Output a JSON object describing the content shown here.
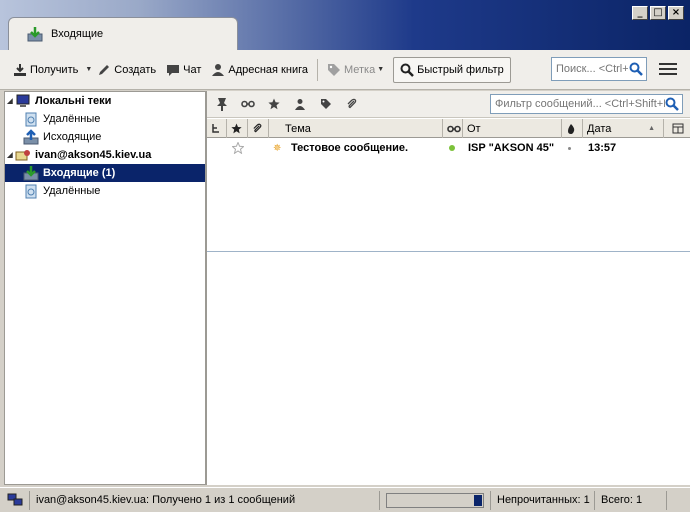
{
  "window": {
    "tab_title": "Входящие",
    "controls": {
      "minimize": "_",
      "maximize": "□",
      "close": "×"
    }
  },
  "toolbar": {
    "get_label": "Получить",
    "write_label": "Создать",
    "chat_label": "Чат",
    "addressbook_label": "Адресная книга",
    "tag_label": "Метка",
    "quickfilter_label": "Быстрый фильтр",
    "search_placeholder": "Поиск... <Ctrl+K>"
  },
  "folders": [
    {
      "label": "Локальні теки",
      "icon": "computer-icon",
      "bold": true,
      "level": 0
    },
    {
      "label": "Удалённые",
      "icon": "trash-icon",
      "level": 1
    },
    {
      "label": "Исходящие",
      "icon": "outbox-icon",
      "level": 1
    },
    {
      "label": "ivan@akson45.kiev.ua",
      "icon": "account-icon",
      "bold": true,
      "level": 0
    },
    {
      "label": "Входящие (1)",
      "icon": "inbox-icon",
      "bold": true,
      "selected": true,
      "level": 1
    },
    {
      "label": "Удалённые",
      "icon": "trash-icon",
      "level": 1
    }
  ],
  "quickfilter": {
    "placeholder": "Фильтр сообщений... <Ctrl+Shift+K>"
  },
  "columns": {
    "subject": "Тема",
    "from": "От",
    "date": "Дата"
  },
  "messages": [
    {
      "subject": "Тестовое сообщение.",
      "from": "ISP \"AKSON 45\"",
      "date": "13:57",
      "unread": true
    }
  ],
  "status": {
    "message": "ivan@akson45.kiev.ua: Получено 1 из 1 сообщений",
    "unread": "Непрочитанных: 1",
    "total": "Всего: 1",
    "progress": 1.0
  },
  "colors": {
    "selection": "#0a246a",
    "title_gradient_end": "#0b2466",
    "link_blue": "#1e5fb4"
  }
}
